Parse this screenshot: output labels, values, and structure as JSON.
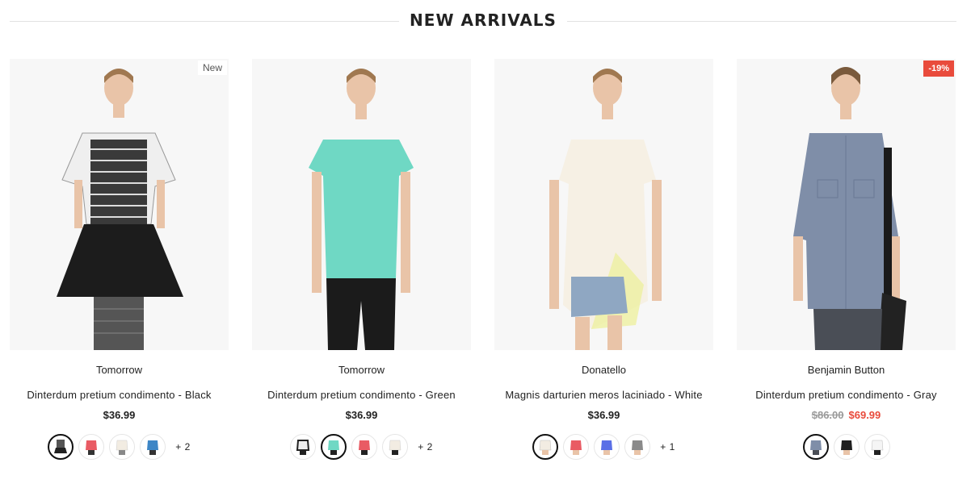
{
  "section": {
    "title": "NEW ARRIVALS"
  },
  "products": [
    {
      "badge": "New",
      "vendor": "Tomorrow",
      "title": "Dinterdum pretium condimento - Black",
      "price": "$36.99",
      "more": "+ 2"
    },
    {
      "vendor": "Tomorrow",
      "title": "Dinterdum pretium condimento - Green",
      "price": "$36.99",
      "more": "+ 2"
    },
    {
      "vendor": "Donatello",
      "title": "Magnis darturien meros laciniado - White",
      "price": "$36.99",
      "more": "+ 1"
    },
    {
      "badge": "-19%",
      "vendor": "Benjamin Button",
      "title": "Dinterdum pretium condimento - Gray",
      "price_old": "$86.00",
      "price_sale": "$69.99"
    }
  ],
  "colors": {
    "sale": "#e94b3c",
    "text": "#222222",
    "muted": "#9a9a9a",
    "rule": "#e2e2e2"
  }
}
